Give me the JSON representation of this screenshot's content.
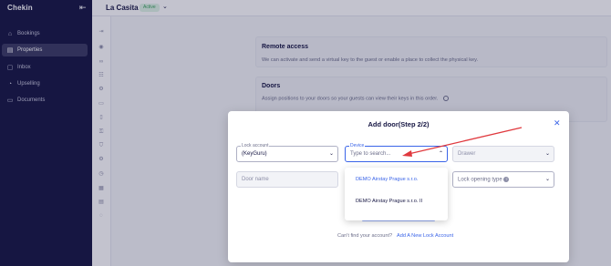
{
  "nav": {
    "logo": "Chekin",
    "items": [
      {
        "label": "Bookings",
        "icon": "house-icon",
        "glyph": "⌂"
      },
      {
        "label": "Properties",
        "icon": "building-icon",
        "glyph": "▤",
        "active": true
      },
      {
        "label": "Inbox",
        "icon": "chat-icon",
        "glyph": "▢"
      },
      {
        "label": "Upselling",
        "icon": "upselling-icon",
        "glyph": "◔"
      },
      {
        "label": "Documents",
        "icon": "document-icon",
        "glyph": "▭"
      }
    ]
  },
  "topbar": {
    "property_name": "La Casita",
    "status": "Active"
  },
  "background": {
    "remote_access_title": "Remote access",
    "remote_access_desc": "We can activate and send a virtual key to the guest or enable a place to collect the physical key.",
    "doors_title": "Doors",
    "doors_desc": "Assign positions to your doors so your guests can view their keys in this order."
  },
  "modal": {
    "title": "Add door(Step 2/2)",
    "lock_account_label": "Lock account",
    "lock_account_value": "(KeyGuru)",
    "device_label": "Device",
    "device_placeholder": "Type to search...",
    "drawer_value": "Drawer",
    "door_name_placeholder": "Door name",
    "lock_opening_type": "Lock opening type",
    "device_options": [
      "DEMO Airstay Prague s.r.o.",
      "DEMO Airstay Prague s.r.o. II"
    ],
    "footer_text": "Can't find your account?",
    "footer_link": "Add A New Lock Account"
  },
  "colors": {
    "sidebar": "#161643",
    "accent": "#3a64e8",
    "annotation_arrow": "#e0393e"
  }
}
